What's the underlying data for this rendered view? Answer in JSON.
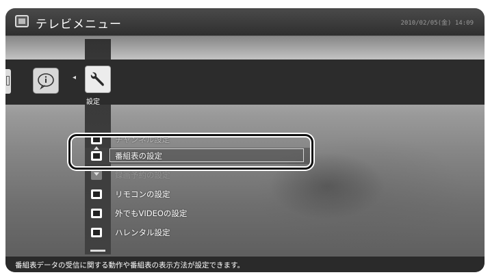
{
  "header": {
    "title": "テレビメニュー",
    "datetime": "2010/02/05(金) 14:09"
  },
  "menu": {
    "settings_label": "設定"
  },
  "settings_list": [
    {
      "label": "チャンネル設定"
    },
    {
      "label": "番組表の設定"
    },
    {
      "label": "録画予約の設定"
    },
    {
      "label": "リモコンの設定"
    },
    {
      "label": "外でもVIDEOの設定"
    },
    {
      "label": "ハレンタル設定"
    }
  ],
  "status": {
    "text": "番組表データの受信に関する動作や番組表の表示方法が設定できます。"
  }
}
